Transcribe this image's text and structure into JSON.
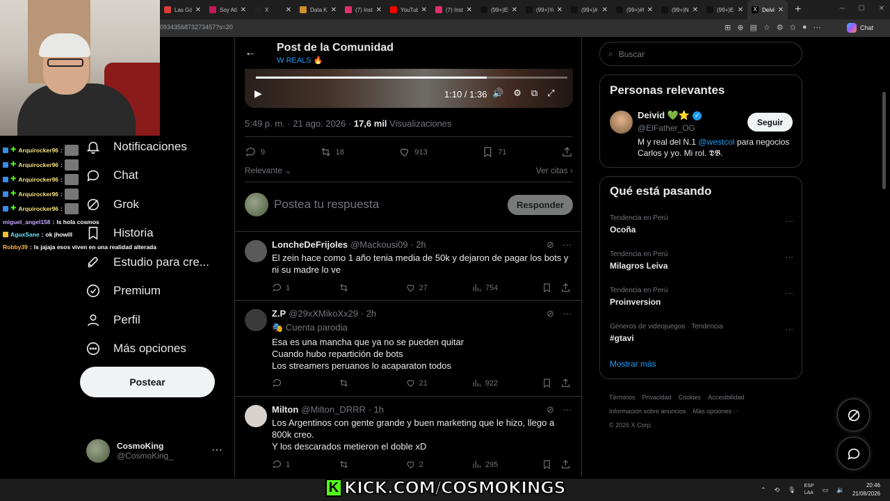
{
  "browser": {
    "tabs": [
      {
        "label": "Las Góti",
        "color": "#e03b3b"
      },
      {
        "label": "Soy Ati",
        "color": "#c2185b"
      },
      {
        "label": "X",
        "color": "#222222"
      },
      {
        "label": "Data Kl",
        "color": "#d08f2c"
      },
      {
        "label": "(7) Insta",
        "color": "#e1306c"
      },
      {
        "label": "YouTub",
        "color": "#ff0000"
      },
      {
        "label": "(7) Insta",
        "color": "#e1306c"
      },
      {
        "label": "(99+)El",
        "color": "#111111"
      },
      {
        "label": "(99+)Yo",
        "color": "#111111"
      },
      {
        "label": "(99+)#",
        "color": "#111111"
      },
      {
        "label": "(99+)#l",
        "color": "#111111"
      },
      {
        "label": "(99+)N",
        "color": "#111111"
      },
      {
        "label": "(99+)E",
        "color": "#111111"
      }
    ],
    "active_tab": {
      "label": "Deivid"
    },
    "url": "0934356873273457?s=20",
    "copilot_label": "Chat"
  },
  "stream_chat": [
    {
      "user": "Arquirocker96",
      "text": "",
      "icon": true
    },
    {
      "user": "Arquirocker96",
      "text": "",
      "icon": true
    },
    {
      "user": "Arquirocker96",
      "text": "",
      "icon": true
    },
    {
      "user": "Arquirocker96",
      "text": "",
      "icon": true
    },
    {
      "user": "Arquirocker96",
      "text": "",
      "icon": true
    },
    {
      "user": "miguel_angel158",
      "text": "ls hola cosmos",
      "icon": false
    },
    {
      "user": "AguxSane",
      "text": "ok jhowill",
      "icon": false
    },
    {
      "user": "Robby39",
      "text": "ls jajaja esos viven en una realidad alterada",
      "icon": false
    }
  ],
  "nav": {
    "items": [
      {
        "label": "Notificaciones",
        "icon": "bell-icon"
      },
      {
        "label": "Chat",
        "icon": "chat-icon"
      },
      {
        "label": "Grok",
        "icon": "grok-icon"
      },
      {
        "label": "Historia",
        "icon": "bookmark-icon"
      },
      {
        "label": "Estudio para cre...",
        "icon": "rocket-icon"
      },
      {
        "label": "Premium",
        "icon": "verified-icon"
      },
      {
        "label": "Perfil",
        "icon": "person-icon"
      },
      {
        "label": "Más opciones",
        "icon": "more-circle-icon"
      }
    ],
    "post_button": "Postear",
    "account": {
      "name": "CosmoKing",
      "handle": "@CosmoKing_"
    }
  },
  "post": {
    "header_title": "Post de la Comunidad",
    "community": "W REALS 🔥",
    "video": {
      "time": "1:10 / 1:36",
      "progress": 0.74
    },
    "meta": {
      "time": "5:49 p. m. · 21 ago. 2026 ·",
      "views": "17,6 mil",
      "views_label": "Visualizaciones"
    },
    "stats": {
      "replies": "9",
      "reposts": "18",
      "likes": "913",
      "bookmarks": "71"
    },
    "sort_label": "Relevante",
    "quotes_label": "Ver citas",
    "reply_placeholder": "Postea tu respuesta",
    "reply_button": "Responder"
  },
  "comments": [
    {
      "name": "LoncheDeFrijoles",
      "handle": "@Mackousi09 · 2h",
      "text": "El zein hace como 1 año tenia media de 50k y dejaron de pagar los bots y ni su madre lo ve",
      "replies": "1",
      "reposts": "",
      "likes": "27",
      "views": "754",
      "avatar_color": "#5a5a5a"
    },
    {
      "name": "Z.P",
      "handle": "@29xXMikoXx29 · 2h",
      "parody": "Cuenta parodia",
      "text_lines": [
        "Esa es una mancha que ya no se pueden quitar",
        "Cuando hubo repartición de bots",
        "Los streamers peruanos lo acaparaton todos"
      ],
      "replies": "",
      "reposts": "",
      "likes": "21",
      "views": "922",
      "avatar_color": "#3a3a3a"
    },
    {
      "name": "Milton",
      "handle": "@Milton_DRRR · 1h",
      "text_lines": [
        "Los Argentinos con gente grande y buen marketing que le hizo, llego a 800k creo.",
        "Y los descarados metieron el doble xD"
      ],
      "replies": "1",
      "reposts": "",
      "likes": "2",
      "views": "295",
      "avatar_color": "#d9d2cc"
    }
  ],
  "sidebar": {
    "search_placeholder": "Buscar",
    "relevant": {
      "title": "Personas relevantes",
      "name": "Deivid 💚⭐",
      "handle": "@ElFather_OG",
      "bio_prefix": "M y real del N.1",
      "bio_mention": "@westcol",
      "bio_suffix": "para negocios Carlos y yo. Mi rol. 𝕯𝕭.",
      "follow": "Seguir"
    },
    "trends": {
      "title": "Qué está pasando",
      "items": [
        {
          "context": "Tendencia en Perú",
          "topic": "Ocoña"
        },
        {
          "context": "Tendencia en Perú",
          "topic": "Milagros Leiva"
        },
        {
          "context": "Tendencia en Perú",
          "topic": "Proinversion"
        },
        {
          "context": "Géneros de videojuegos · Tendencia",
          "topic": "#gtavi"
        }
      ],
      "show_more": "Mostrar más"
    },
    "footer": [
      "Términos",
      "Privacidad",
      "Cookies",
      "Accesibilidad",
      "Información sobre anuncios",
      "Más opciones ···",
      "© 2026 X Corp."
    ]
  },
  "overlay": {
    "kick_text": "KICK.COM/COSMOKINGS",
    "kick_logo": "K"
  },
  "taskbar": {
    "lang_top": "ESP",
    "lang_bottom": "LAA",
    "time": "20:46",
    "date": "21/08/2026"
  }
}
